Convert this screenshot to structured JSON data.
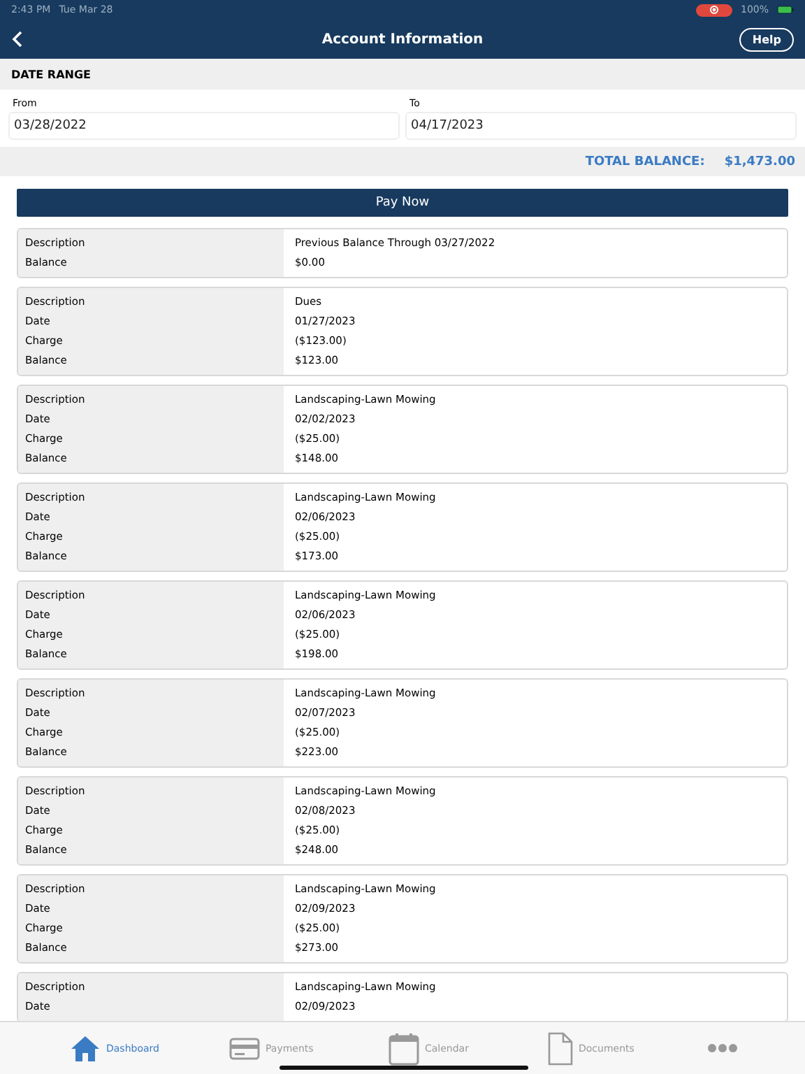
{
  "status_bar": {
    "time": "2:43 PM",
    "date": "Tue Mar 28",
    "battery": "100%"
  },
  "nav": {
    "title": "Account Information",
    "help": "Help"
  },
  "date_range": {
    "heading": "DATE RANGE",
    "from": {
      "label": "From",
      "value": "03/28/2022"
    },
    "to": {
      "label": "To",
      "value": "04/17/2023"
    }
  },
  "total": {
    "label": "TOTAL BALANCE:",
    "amount": "$1,473.00"
  },
  "pay_button": "Pay Now",
  "entries": [
    {
      "rows": [
        [
          "Description",
          "Previous Balance Through 03/27/2022"
        ],
        [
          "Balance",
          "$0.00"
        ]
      ]
    },
    {
      "rows": [
        [
          "Description",
          "Dues"
        ],
        [
          "Date",
          "01/27/2023"
        ],
        [
          "Charge",
          "($123.00)"
        ],
        [
          "Balance",
          "$123.00"
        ]
      ]
    },
    {
      "rows": [
        [
          "Description",
          "Landscaping-Lawn Mowing"
        ],
        [
          "Date",
          "02/02/2023"
        ],
        [
          "Charge",
          "($25.00)"
        ],
        [
          "Balance",
          "$148.00"
        ]
      ]
    },
    {
      "rows": [
        [
          "Description",
          "Landscaping-Lawn Mowing"
        ],
        [
          "Date",
          "02/06/2023"
        ],
        [
          "Charge",
          "($25.00)"
        ],
        [
          "Balance",
          "$173.00"
        ]
      ]
    },
    {
      "rows": [
        [
          "Description",
          "Landscaping-Lawn Mowing"
        ],
        [
          "Date",
          "02/06/2023"
        ],
        [
          "Charge",
          "($25.00)"
        ],
        [
          "Balance",
          "$198.00"
        ]
      ]
    },
    {
      "rows": [
        [
          "Description",
          "Landscaping-Lawn Mowing"
        ],
        [
          "Date",
          "02/07/2023"
        ],
        [
          "Charge",
          "($25.00)"
        ],
        [
          "Balance",
          "$223.00"
        ]
      ]
    },
    {
      "rows": [
        [
          "Description",
          "Landscaping-Lawn Mowing"
        ],
        [
          "Date",
          "02/08/2023"
        ],
        [
          "Charge",
          "($25.00)"
        ],
        [
          "Balance",
          "$248.00"
        ]
      ]
    },
    {
      "rows": [
        [
          "Description",
          "Landscaping-Lawn Mowing"
        ],
        [
          "Date",
          "02/09/2023"
        ],
        [
          "Charge",
          "($25.00)"
        ],
        [
          "Balance",
          "$273.00"
        ]
      ]
    },
    {
      "rows": [
        [
          "Description",
          "Landscaping-Lawn Mowing"
        ],
        [
          "Date",
          "02/09/2023"
        ]
      ]
    }
  ],
  "tabs": [
    {
      "kind": "home",
      "label": "Dashboard",
      "selected": true
    },
    {
      "kind": "card",
      "label": "Payments",
      "selected": false
    },
    {
      "kind": "calendar",
      "label": "Calendar",
      "selected": false
    },
    {
      "kind": "document",
      "label": "Documents",
      "selected": false
    },
    {
      "kind": "more",
      "selected": false
    }
  ]
}
